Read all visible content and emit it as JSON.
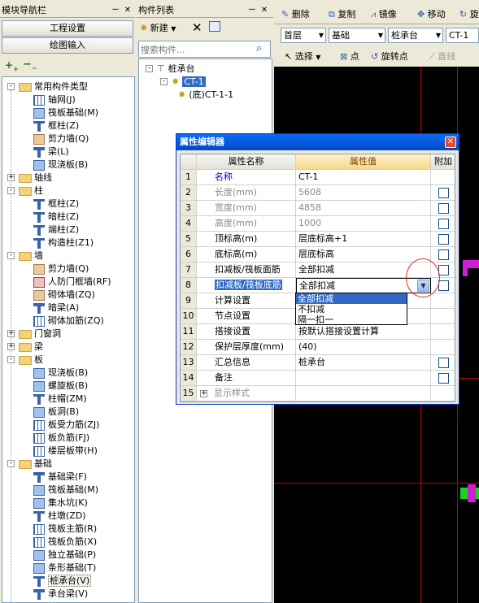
{
  "nav": {
    "title": "模块导航栏",
    "project_btn": "工程设置",
    "draw_btn": "绘图输入",
    "tree": [
      {
        "label": "常用构件类型",
        "type": "folder",
        "toggle": "-"
      },
      {
        "label": "轴网(J)",
        "type": "grid"
      },
      {
        "label": "筏板基础(M)",
        "type": "slab"
      },
      {
        "label": "框柱(Z)",
        "type": "col"
      },
      {
        "label": "剪力墙(Q)",
        "type": "wall"
      },
      {
        "label": "梁(L)",
        "type": "beam"
      },
      {
        "label": "现浇板(B)",
        "type": "slab"
      },
      {
        "label": "轴线",
        "type": "folder",
        "toggle": "+"
      },
      {
        "label": "柱",
        "type": "folder",
        "toggle": "-"
      },
      {
        "label": "框柱(Z)",
        "type": "col"
      },
      {
        "label": "暗柱(Z)",
        "type": "col"
      },
      {
        "label": "端柱(Z)",
        "type": "col"
      },
      {
        "label": "构造柱(Z1)",
        "type": "col"
      },
      {
        "label": "墙",
        "type": "folder",
        "toggle": "-"
      },
      {
        "label": "剪力墙(Q)",
        "type": "wall"
      },
      {
        "label": "人防门框墙(RF)",
        "type": "red"
      },
      {
        "label": "砌体墙(ZQ)",
        "type": "wall"
      },
      {
        "label": "暗梁(A)",
        "type": "beam"
      },
      {
        "label": "砌体加筋(ZQ)",
        "type": "grid"
      },
      {
        "label": "门窗洞",
        "type": "folder",
        "toggle": "+"
      },
      {
        "label": "梁",
        "type": "folder",
        "toggle": "+"
      },
      {
        "label": "板",
        "type": "folder",
        "toggle": "-"
      },
      {
        "label": "现浇板(B)",
        "type": "slab"
      },
      {
        "label": "螺旋板(B)",
        "type": "slab"
      },
      {
        "label": "柱帽(ZM)",
        "type": "col"
      },
      {
        "label": "板洞(B)",
        "type": "slab"
      },
      {
        "label": "板受力筋(ZJ)",
        "type": "grid"
      },
      {
        "label": "板负筋(FJ)",
        "type": "grid"
      },
      {
        "label": "楼层板带(H)",
        "type": "grid"
      },
      {
        "label": "基础",
        "type": "folder",
        "toggle": "-"
      },
      {
        "label": "基础梁(F)",
        "type": "beam"
      },
      {
        "label": "筏板基础(M)",
        "type": "slab"
      },
      {
        "label": "集水坑(K)",
        "type": "slab"
      },
      {
        "label": "柱墩(ZD)",
        "type": "col"
      },
      {
        "label": "筏板主筋(R)",
        "type": "grid"
      },
      {
        "label": "筏板负筋(X)",
        "type": "grid"
      },
      {
        "label": "独立基础(P)",
        "type": "slab"
      },
      {
        "label": "条形基础(T)",
        "type": "slab"
      },
      {
        "label": "桩承台(V)",
        "type": "col",
        "selected": true
      },
      {
        "label": "承台梁(V)",
        "type": "beam"
      },
      {
        "label": "桩(U)",
        "type": "col"
      }
    ]
  },
  "list": {
    "title": "构件列表",
    "new_btn": "新建",
    "search_placeholder": "搜索构件...",
    "tree": [
      {
        "label": "桩承台",
        "level": 0
      },
      {
        "label": "CT-1",
        "level": 1
      },
      {
        "label": "(底)CT-1-1",
        "level": 2
      }
    ]
  },
  "toolbar": {
    "delete": "删除",
    "copy": "复制",
    "mirror": "镜像",
    "move": "移动",
    "rotate": "旋",
    "floor": "首层",
    "category": "基础",
    "type": "桩承台",
    "member": "CT-1",
    "select": "选择",
    "point": "点",
    "rotate_point": "旋转点",
    "line": "直线"
  },
  "dialog": {
    "title": "属性编辑器",
    "col_name": "属性名称",
    "col_value": "属性值",
    "col_extra": "附加",
    "rows": [
      {
        "num": "1",
        "name": "名称",
        "value": "CT-1",
        "name_color": "#0000cc",
        "check": false
      },
      {
        "num": "2",
        "name": "长度(mm)",
        "value": "5608",
        "gray": true,
        "check": true
      },
      {
        "num": "3",
        "name": "宽度(mm)",
        "value": "4858",
        "gray": true,
        "check": true
      },
      {
        "num": "4",
        "name": "高度(mm)",
        "value": "1000",
        "gray": true,
        "check": true
      },
      {
        "num": "5",
        "name": "顶标高(m)",
        "value": "层底标高+1",
        "check": true
      },
      {
        "num": "6",
        "name": "底标高(m)",
        "value": "层底标高",
        "check": true
      },
      {
        "num": "7",
        "name": "扣减板/筏板面筋",
        "value": "全部扣减",
        "check": true
      },
      {
        "num": "8",
        "name": "扣减板/筏板底筋",
        "value": "全部扣减",
        "selected": true,
        "check": true
      },
      {
        "num": "9",
        "name": "计算设置",
        "value": "",
        "check": false
      },
      {
        "num": "10",
        "name": "节点设置",
        "value": "",
        "check": false
      },
      {
        "num": "11",
        "name": "搭接设置",
        "value": "按默认搭接设置计算",
        "check": false
      },
      {
        "num": "12",
        "name": "保护层厚度(mm)",
        "value": "(40)",
        "check": false
      },
      {
        "num": "13",
        "name": "汇总信息",
        "value": "桩承台",
        "check": true
      },
      {
        "num": "14",
        "name": "备注",
        "value": "",
        "check": true
      },
      {
        "num": "15",
        "name": "显示样式",
        "value": "",
        "gray": true,
        "toggle": "+",
        "check": false
      }
    ],
    "dropdown_options": [
      "全部扣减",
      "不扣减",
      "隔一扣一"
    ]
  }
}
